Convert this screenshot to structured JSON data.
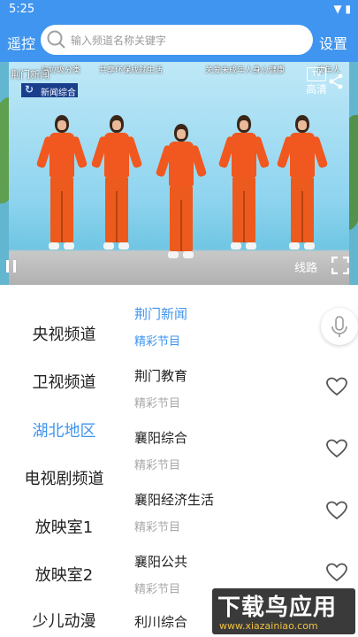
{
  "status_bar": {
    "time": "5:25",
    "icons_text": "▼ ▮"
  },
  "header": {
    "remote_label": "遥控",
    "settings_label": "设置",
    "search_placeholder": "输入频道名称关键字"
  },
  "player": {
    "channel_name": "荆门新闻",
    "logo_text": "新闻综合",
    "logo_mark": "↻",
    "ticker": [
      "与垃圾分类",
      "共享环保成就生活",
      "关爱未成年人身心健康",
      "成年人"
    ],
    "badge_tv": "TV",
    "quality_label": "高清",
    "route_label": "线路"
  },
  "categories": [
    {
      "label": "央视频道"
    },
    {
      "label": "卫视频道"
    },
    {
      "label": "湖北地区",
      "active": true
    },
    {
      "label": "电视剧频道"
    },
    {
      "label": "放映室1"
    },
    {
      "label": "放映室2"
    },
    {
      "label": "少儿动漫"
    }
  ],
  "channels": [
    {
      "name": "荆门新闻",
      "subtitle": "精彩节目",
      "active": true
    },
    {
      "name": "荆门教育",
      "subtitle": "精彩节目"
    },
    {
      "name": "襄阳综合",
      "subtitle": "精彩节目"
    },
    {
      "name": "襄阳经济生活",
      "subtitle": "精彩节目"
    },
    {
      "name": "襄阳公共",
      "subtitle": "精彩节目"
    },
    {
      "name": "利川综合",
      "subtitle": ""
    }
  ],
  "watermark": {
    "title": "下载鸟应用",
    "url": "www.xiazainiao.com"
  },
  "colors": {
    "accent": "#3f95ef",
    "uniform": "#f0581f"
  }
}
